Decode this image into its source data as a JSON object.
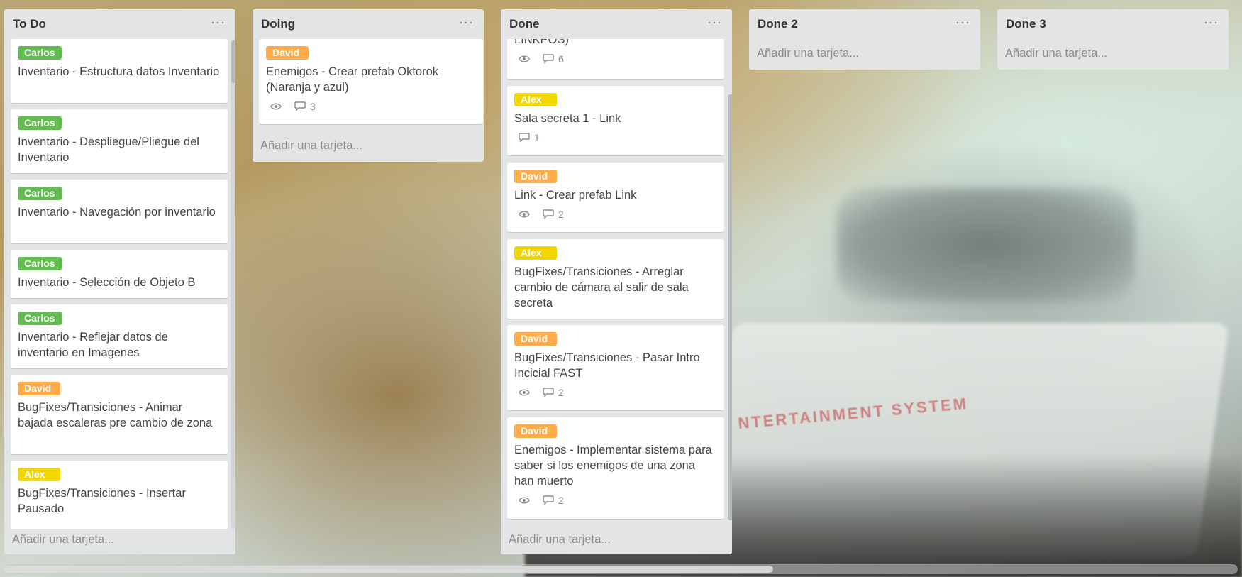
{
  "background_text": "NTERTAINMENT SYSTEM",
  "lists": {
    "todo": {
      "title": "To Do",
      "add_label": "Añadir una tarjeta...",
      "cards": [
        {
          "label": "Carlos",
          "title": "Inventario - Estructura datos Inventario"
        },
        {
          "label": "Carlos",
          "title": "Inventario - Despliegue/Pliegue del Inventario"
        },
        {
          "label": "Carlos",
          "title": "Inventario - Navegación por inventario"
        },
        {
          "label": "Carlos",
          "title": "Inventario - Selección de Objeto B"
        },
        {
          "label": "Carlos",
          "title": "Inventario - Reflejar datos de inventario en Imagenes"
        },
        {
          "label": "David",
          "title": "BugFixes/Transiciones - Animar bajada escaleras pre cambio de zona"
        },
        {
          "label": "Alex",
          "title": "BugFixes/Transiciones - Insertar Pausado"
        }
      ]
    },
    "doing": {
      "title": "Doing",
      "add_label": "Añadir una tarjeta...",
      "cards": [
        {
          "label": "David",
          "title": "Enemigos - Crear prefab Oktorok (Naranja y azul)",
          "comments": "3"
        }
      ]
    },
    "done": {
      "title": "Done",
      "add_label": "Añadir una tarjeta...",
      "cards": [
        {
          "title": "LINKPOS)",
          "comments": "6"
        },
        {
          "label": "Alex",
          "title": "Sala secreta 1 - Link",
          "comments": "1"
        },
        {
          "label": "David",
          "title": "Link - Crear prefab Link",
          "comments": "2"
        },
        {
          "label": "Alex",
          "title": "BugFixes/Transiciones - Arreglar cambio de cámara al salir de sala secreta"
        },
        {
          "label": "David",
          "title": "BugFixes/Transiciones - Pasar Intro Incicial FAST",
          "comments": "2"
        },
        {
          "label": "David",
          "title": "Enemigos - Implementar sistema para saber si los enemigos de una zona han muerto",
          "comments": "2"
        }
      ]
    },
    "done2": {
      "title": "Done 2",
      "add_label": "Añadir una tarjeta..."
    },
    "done3": {
      "title": "Done 3",
      "add_label": "Añadir una tarjeta..."
    }
  },
  "menu_glyph": "···",
  "colors": {
    "list_bg": "#e2e4e6",
    "green": "#61bd4f",
    "orange": "#ffab4a",
    "yellow": "#f2d600"
  },
  "icons": {
    "watch": "eye-icon",
    "comments": "comment-icon"
  }
}
